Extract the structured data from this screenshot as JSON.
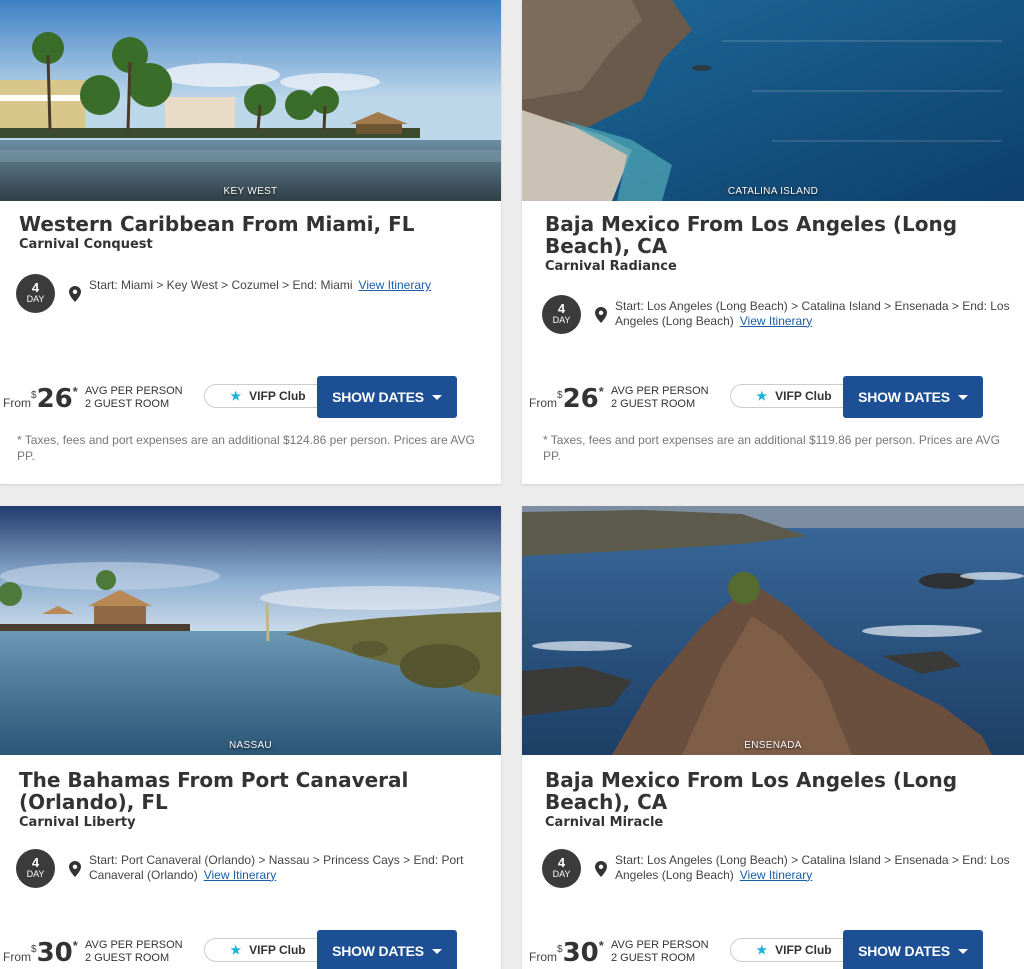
{
  "cards": [
    {
      "location": "KEY WEST",
      "title": "Western Caribbean From Miami, FL",
      "ship": "Carnival Conquest",
      "day_num": "4",
      "day_unit": "DAY",
      "route": "Start: Miami > Key West > Cozumel > End: Miami",
      "itinerary_link": "View Itinerary",
      "from_label": "From",
      "currency": "$",
      "price": "26",
      "asterisk": "*",
      "per_line1": "AVG PER PERSON",
      "per_line2": "2 GUEST ROOM",
      "vifp_label": "VIFP Club",
      "dates_label": "SHOW DATES",
      "note": "* Taxes, fees and port expenses are an additional $124.86 per person. Prices are AVG PP."
    },
    {
      "location": "CATALINA ISLAND",
      "title": "Baja Mexico From Los Angeles (Long Beach), CA",
      "ship": "Carnival Radiance",
      "day_num": "4",
      "day_unit": "DAY",
      "route": "Start: Los Angeles (Long Beach) > Catalina Island > Ensenada > End: Los Angeles (Long Beach)",
      "itinerary_link": "View Itinerary",
      "from_label": "From",
      "currency": "$",
      "price": "26",
      "asterisk": "*",
      "per_line1": "AVG PER PERSON",
      "per_line2": "2 GUEST ROOM",
      "vifp_label": "VIFP Club",
      "dates_label": "SHOW DATES",
      "note": "* Taxes, fees and port expenses are an additional $119.86 per person. Prices are AVG PP."
    },
    {
      "location": "NASSAU",
      "title": "The Bahamas From Port Canaveral (Orlando), FL",
      "ship": "Carnival Liberty",
      "day_num": "4",
      "day_unit": "DAY",
      "route": "Start: Port Canaveral (Orlando) > Nassau > Princess Cays > End: Port Canaveral (Orlando)",
      "itinerary_link": "View Itinerary",
      "from_label": "From",
      "currency": "$",
      "price": "30",
      "asterisk": "*",
      "per_line1": "AVG PER PERSON",
      "per_line2": "2 GUEST ROOM",
      "vifp_label": "VIFP Club",
      "dates_label": "SHOW DATES"
    },
    {
      "location": "ENSENADA",
      "title": "Baja Mexico From Los Angeles (Long Beach), CA",
      "ship": "Carnival Miracle",
      "day_num": "4",
      "day_unit": "DAY",
      "route": "Start: Los Angeles (Long Beach) > Catalina Island > Ensenada > End: Los Angeles (Long Beach)",
      "itinerary_link": "View Itinerary",
      "from_label": "From",
      "currency": "$",
      "price": "30",
      "asterisk": "*",
      "per_line1": "AVG PER PERSON",
      "per_line2": "2 GUEST ROOM",
      "vifp_label": "VIFP Club",
      "dates_label": "SHOW DATES"
    }
  ],
  "colors": {
    "primary_button": "#1d4f95",
    "link": "#1a5fa8",
    "star": "#1ab0d8",
    "day_badge": "#3b3b3b"
  }
}
